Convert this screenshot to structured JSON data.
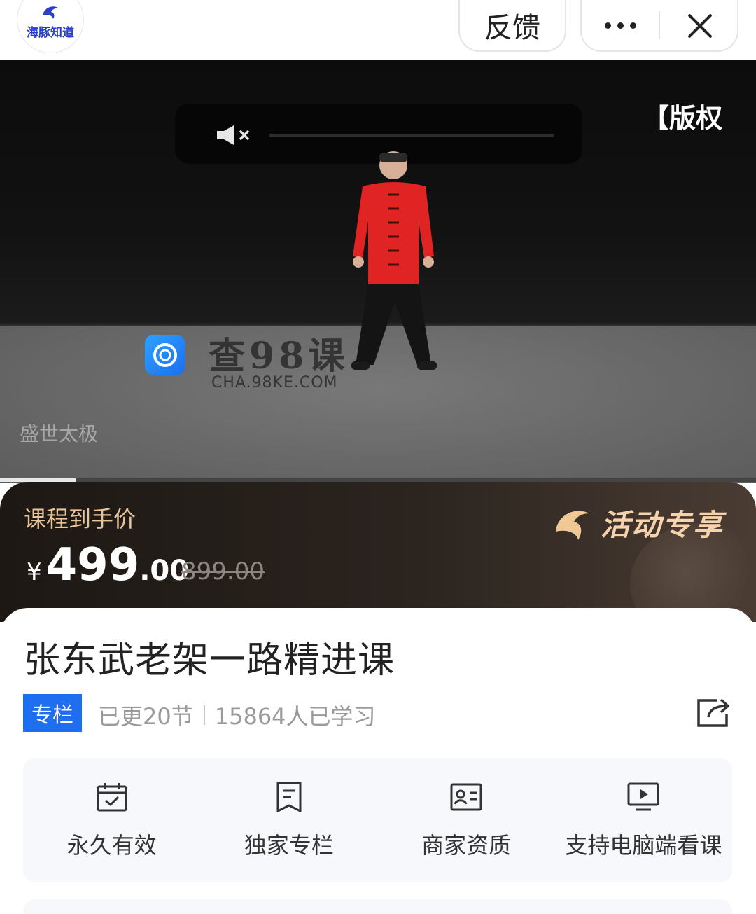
{
  "header": {
    "logo_text": "海豚知道",
    "feedback_label": "反馈",
    "more_icon": "more-dots-icon",
    "close_icon": "close-icon"
  },
  "video": {
    "copyright_tag": "【版权",
    "watermark_title": "查98课",
    "watermark_url": "CHA.98KE.COM",
    "caption": "盛世太极",
    "muted": true,
    "progress_fraction": 0.1
  },
  "promo": {
    "label": "课程到手价",
    "currency": "¥",
    "price_integer": "499",
    "price_decimal": ".00",
    "original_price": "899.00",
    "badge_text": "活动专享"
  },
  "course": {
    "title": "张东武老架一路精进课",
    "tag": "专栏",
    "updated": "已更20节",
    "learners": "15864人已学习"
  },
  "features": [
    {
      "icon": "calendar-check-icon",
      "label": "永久有效"
    },
    {
      "icon": "document-icon",
      "label": "独家专栏"
    },
    {
      "icon": "id-card-icon",
      "label": "商家资质"
    },
    {
      "icon": "monitor-play-icon",
      "label": "支持电脑端看课"
    }
  ],
  "colors": {
    "accent_blue": "#1d6fef",
    "promo_gold": "#e8c49a",
    "promo_bg": "#2b241f",
    "jacket_red": "#e02424"
  }
}
